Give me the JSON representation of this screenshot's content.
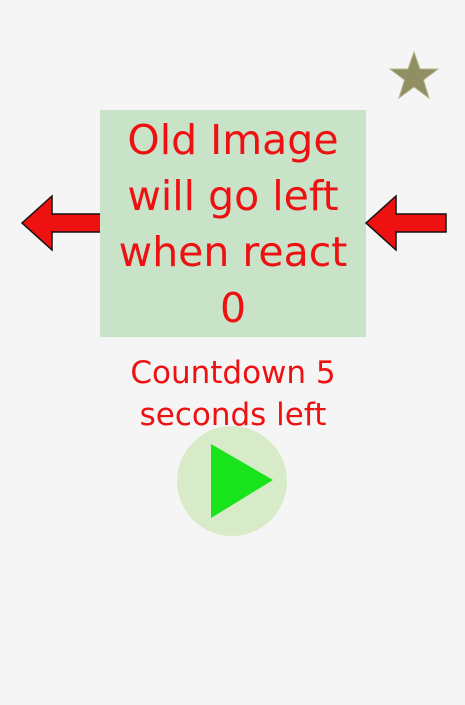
{
  "card": {
    "text": "Old Image\nwill go left\nwhen react\n0",
    "background_color": "#c9e3c9",
    "text_color": "#ee1111"
  },
  "countdown": {
    "text": "Countdown 5\nseconds left"
  },
  "icons": {
    "star": "star-icon",
    "left_arrow": "arrow-left-icon",
    "right_arrow": "arrow-right-icon",
    "play": "play-icon"
  },
  "colors": {
    "arrow": "#ee1111",
    "star": "#8f8f63",
    "play_fill": "#19e31a",
    "play_bg": "#d7ebc9"
  }
}
